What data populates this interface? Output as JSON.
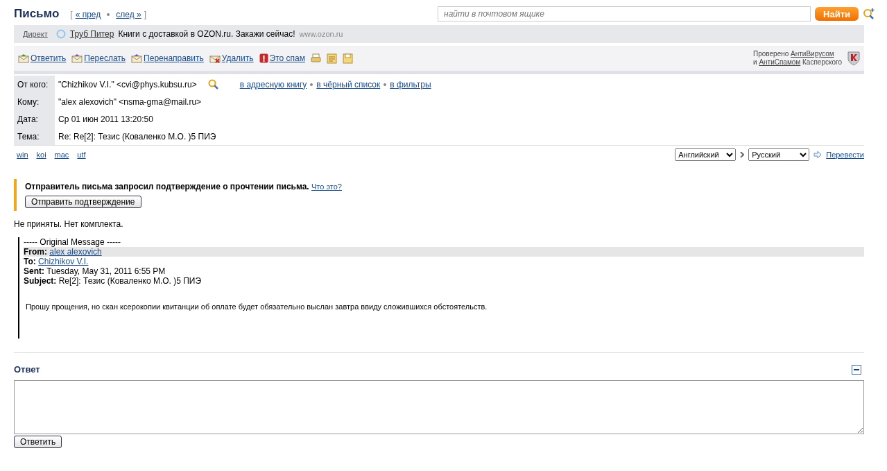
{
  "header": {
    "title": "Письмо",
    "nav": [
      "« пред",
      "след »"
    ],
    "nav_open": "[",
    "nav_close": "]"
  },
  "search": {
    "placeholder": "найти в почтовом ящике",
    "button": "Найти"
  },
  "ad": {
    "label": "Директ",
    "link": "Труб Питер",
    "text": "Книги с доставкой в OZON.ru. Закажи сейчас!",
    "url": "www.ozon.ru"
  },
  "toolbar": {
    "actions": [
      "Ответить",
      "Переслать",
      "Перенаправить",
      "Удалить",
      "Это спам"
    ],
    "antivirus": {
      "prefix": "Проверено",
      "link1": "АнтиВирусом",
      "conj": "и",
      "link2": "АнтиСпамом",
      "suffix": "Касперского"
    }
  },
  "headers": [
    {
      "label": "От кого:",
      "value": "\"Chizhikov V.I.\" <cvi@phys.kubsu.ru>",
      "links": [
        "в адресную книгу",
        "в чёрный список",
        "в фильтры"
      ]
    },
    {
      "label": "Кому:",
      "value": "\"alex alexovich\" <nsma-gma@mail.ru>"
    },
    {
      "label": "Дата:",
      "value": "Ср 01 июн 2011 13:20:50"
    },
    {
      "label": "Тема:",
      "value": "Re: Re[2]: Тезис (Коваленко М.О. )5 ПИЭ"
    }
  ],
  "encodings": [
    "win",
    "koi",
    "mac",
    "utf"
  ],
  "translate": {
    "from": "Английский",
    "to": "Русский",
    "button": "Перевести"
  },
  "receipt": {
    "text": "Отправитель письма запросил подтверждение о прочтении письма.",
    "help": "Что это?",
    "button": "Отправить подтверждение"
  },
  "body": {
    "text": "Не приняты. Нет комплекта.",
    "quote": {
      "separator": "----- Original Message -----",
      "fields": [
        {
          "label": "From:",
          "value": "alex alexovich",
          "kind": "link",
          "highlighted": true
        },
        {
          "label": "To:",
          "value": "Chizhikov V.I.",
          "kind": "link",
          "highlighted": false
        },
        {
          "label": "Sent:",
          "value": "Tuesday, May 31, 2011 6:55 PM",
          "kind": "text",
          "highlighted": false
        },
        {
          "label": "Subject:",
          "value": "Re[2]: Тезис (Коваленко М.О. )5 ПИЭ",
          "kind": "text",
          "highlighted": false
        }
      ],
      "text": "Прошу прощения, но скан ксерокопии квитанции об оплате будет обязательно  выслан завтра  ввиду сложившихся обстоятельств."
    }
  },
  "reply": {
    "title": "Ответ",
    "button": "Ответить"
  }
}
